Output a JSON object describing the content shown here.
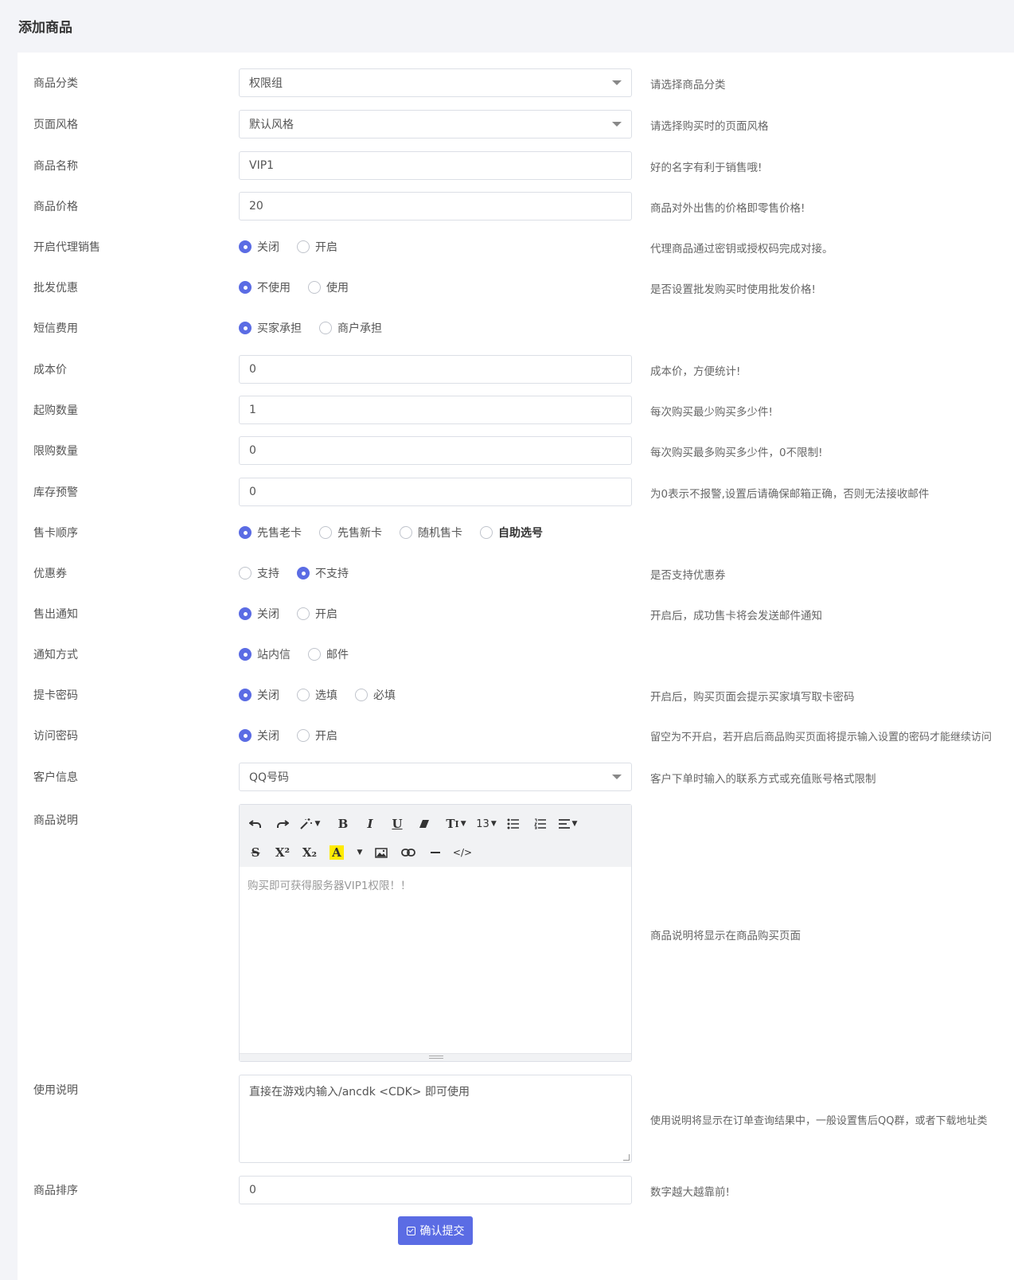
{
  "page_title": "添加商品",
  "accent_color": "#5b6ce4",
  "fields": {
    "category": {
      "label": "商品分类",
      "value": "权限组",
      "help": "请选择商品分类"
    },
    "style": {
      "label": "页面风格",
      "value": "默认风格",
      "help": "请选择购买时的页面风格"
    },
    "name": {
      "label": "商品名称",
      "value": "VIP1",
      "help": "好的名字有利于销售哦!"
    },
    "price": {
      "label": "商品价格",
      "value": "20",
      "help": "商品对外出售的价格即零售价格!"
    },
    "agent": {
      "label": "开启代理销售",
      "options": [
        "关闭",
        "开启"
      ],
      "selected": "关闭",
      "help": "代理商品通过密钥或授权码完成对接。"
    },
    "wholesale": {
      "label": "批发优惠",
      "options": [
        "不使用",
        "使用"
      ],
      "selected": "不使用",
      "help": "是否设置批发购买时使用批发价格!"
    },
    "sms_fee": {
      "label": "短信费用",
      "options": [
        "买家承担",
        "商户承担"
      ],
      "selected": "买家承担"
    },
    "cost": {
      "label": "成本价",
      "value": "0",
      "help": "成本价，方便统计!"
    },
    "min_qty": {
      "label": "起购数量",
      "value": "1",
      "help": "每次购买最少购买多少件!"
    },
    "max_qty": {
      "label": "限购数量",
      "value": "0",
      "help": "每次购买最多购买多少件，0不限制!"
    },
    "stock_alert": {
      "label": "库存预警",
      "value": "0",
      "help": "为0表示不报警,设置后请确保邮箱正确，否则无法接收邮件"
    },
    "sell_order": {
      "label": "售卡顺序",
      "options": [
        "先售老卡",
        "先售新卡",
        "随机售卡",
        "自助选号"
      ],
      "selected": "先售老卡"
    },
    "coupon": {
      "label": "优惠券",
      "options": [
        "支持",
        "不支持"
      ],
      "selected": "不支持",
      "help": "是否支持优惠券"
    },
    "sale_notify": {
      "label": "售出通知",
      "options": [
        "关闭",
        "开启"
      ],
      "selected": "关闭",
      "help": "开启后，成功售卡将会发送邮件通知"
    },
    "notify_method": {
      "label": "通知方式",
      "options": [
        "站内信",
        "邮件"
      ],
      "selected": "站内信"
    },
    "card_password": {
      "label": "提卡密码",
      "options": [
        "关闭",
        "选填",
        "必填"
      ],
      "selected": "关闭",
      "help": "开启后，购买页面会提示买家填写取卡密码"
    },
    "visit_password": {
      "label": "访问密码",
      "options": [
        "关闭",
        "开启"
      ],
      "selected": "关闭",
      "help": "留空为不开启，若开启后商品购买页面将提示输入设置的密码才能继续访问"
    },
    "customer_info": {
      "label": "客户信息",
      "value": "QQ号码",
      "help": "客户下单时输入的联系方式或充值账号格式限制"
    },
    "description": {
      "label": "商品说明",
      "placeholder": "购买即可获得服务器VIP1权限！！",
      "help": "商品说明将显示在商品购买页面"
    },
    "usage": {
      "label": "使用说明",
      "value": "直接在游戏内输入/ancdk <CDK> 即可使用",
      "help": "使用说明将显示在订单查询结果中，一般设置售后QQ群，或者下载地址类"
    },
    "sort": {
      "label": "商品排序",
      "value": "0",
      "help": "数字越大越靠前!"
    }
  },
  "editor_toolbar": {
    "font_size": "13",
    "text_format_label": "T",
    "superscript_label": "X²",
    "subscript_label": "X₂",
    "font_color_label": "A",
    "code_label": "</>"
  },
  "submit_label": "确认提交"
}
